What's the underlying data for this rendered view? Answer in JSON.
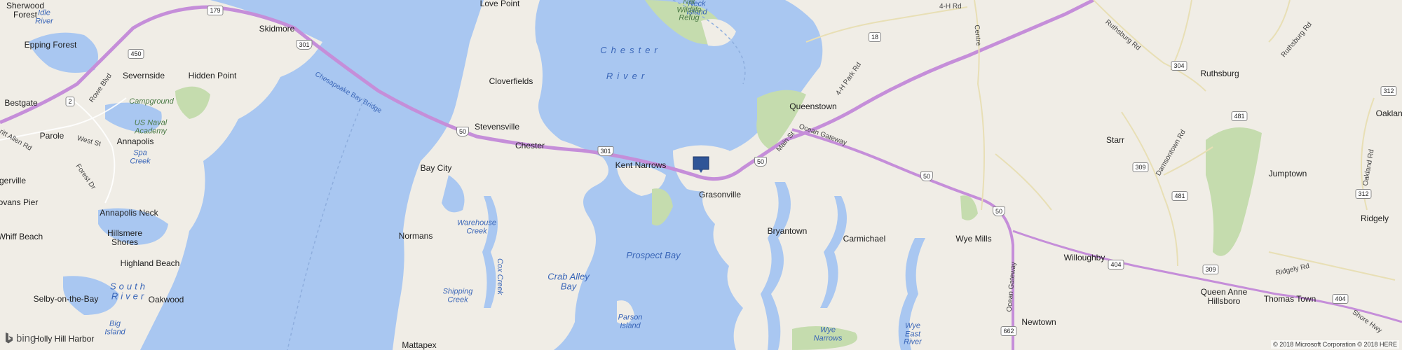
{
  "map": {
    "colors": {
      "water": "#a9c7f1",
      "land": "#f0ede6",
      "park": "#c5dcae",
      "highway": "#c58ed9",
      "marker": "#2f5597"
    },
    "places": [
      {
        "id": "sherwood-forest",
        "text": "Sherwood\nForest"
      },
      {
        "id": "epping-forest",
        "text": "Epping Forest"
      },
      {
        "id": "skidmore",
        "text": "Skidmore"
      },
      {
        "id": "severnside",
        "text": "Severnside"
      },
      {
        "id": "hidden-point",
        "text": "Hidden Point"
      },
      {
        "id": "bestgate",
        "text": "Bestgate"
      },
      {
        "id": "parole",
        "text": "Parole"
      },
      {
        "id": "annapolis",
        "text": "Annapolis"
      },
      {
        "id": "gerville",
        "text": "gerville"
      },
      {
        "id": "ovans-pier",
        "text": "ovans Pier"
      },
      {
        "id": "annapolis-neck",
        "text": "Annapolis Neck"
      },
      {
        "id": "whiff-beach",
        "text": "Whiff Beach"
      },
      {
        "id": "hillsmere-shores",
        "text": "Hillsmere\nShores"
      },
      {
        "id": "highland-beach",
        "text": "Highland Beach"
      },
      {
        "id": "selby-on-the-bay",
        "text": "Selby-on-the-Bay"
      },
      {
        "id": "oakwood",
        "text": "Oakwood"
      },
      {
        "id": "holly-hill-harbor",
        "text": "Holly Hill Harbor"
      },
      {
        "id": "love-point",
        "text": "Love Point"
      },
      {
        "id": "cloverfields",
        "text": "Cloverfields"
      },
      {
        "id": "stevensville",
        "text": "Stevensville"
      },
      {
        "id": "chester",
        "text": "Chester"
      },
      {
        "id": "bay-city",
        "text": "Bay City"
      },
      {
        "id": "normans",
        "text": "Normans"
      },
      {
        "id": "mattapex",
        "text": "Mattapex"
      },
      {
        "id": "kent-narrows",
        "text": "Kent Narrows"
      },
      {
        "id": "grasonville",
        "text": "Grasonville"
      },
      {
        "id": "queenstown",
        "text": "Queenstown"
      },
      {
        "id": "bryantown",
        "text": "Bryantown"
      },
      {
        "id": "carmichael",
        "text": "Carmichael"
      },
      {
        "id": "wye-mills",
        "text": "Wye Mills"
      },
      {
        "id": "starr",
        "text": "Starr"
      },
      {
        "id": "ruthsburg",
        "text": "Ruthsburg"
      },
      {
        "id": "jumptown",
        "text": "Jumptown"
      },
      {
        "id": "oakland",
        "text": "Oakland"
      },
      {
        "id": "ridgely",
        "text": "Ridgely"
      },
      {
        "id": "willoughby",
        "text": "Willoughby"
      },
      {
        "id": "newtown",
        "text": "Newtown"
      },
      {
        "id": "queen-anne-hillsboro",
        "text": "Queen Anne\nHillsboro"
      },
      {
        "id": "thomas-town",
        "text": "Thomas Town"
      }
    ],
    "water_labels": [
      {
        "id": "idle-river",
        "text": "Idle\nRiver"
      },
      {
        "id": "chester-river-1",
        "text": "Chester"
      },
      {
        "id": "chester-river-2",
        "text": "River"
      },
      {
        "id": "warehouse-creek",
        "text": "Warehouse\nCreek"
      },
      {
        "id": "cox-creek",
        "text": "Cox Creek"
      },
      {
        "id": "prospect-bay",
        "text": "Prospect Bay"
      },
      {
        "id": "crab-alley-bay",
        "text": "Crab Alley\nBay"
      },
      {
        "id": "shipping-creek",
        "text": "Shipping\nCreek"
      },
      {
        "id": "south-river",
        "text": "South\nRiver"
      },
      {
        "id": "spa-creek",
        "text": "Spa\nCreek"
      },
      {
        "id": "big-island",
        "text": "Big\nIsland"
      },
      {
        "id": "parson-island",
        "text": "Parson\nIsland"
      },
      {
        "id": "wye-narrows",
        "text": "Wye\nNarrows"
      },
      {
        "id": "wye-east-river",
        "text": "Wye\nEast\nRiver"
      },
      {
        "id": "neck-island",
        "text": "Neck\nIsland"
      }
    ],
    "park_labels": [
      {
        "id": "campground",
        "text": "Campground"
      },
      {
        "id": "us-naval-academy",
        "text": "US Naval\nAcademy"
      },
      {
        "id": "wildlife-refuge",
        "text": "Nat\nWildlife\nRefug"
      }
    ],
    "roads": [
      {
        "id": "rowe-blvd",
        "text": "Rowe Blvd"
      },
      {
        "id": "west-st",
        "text": "West St"
      },
      {
        "id": "forest-dr",
        "text": "Forest Dr"
      },
      {
        "id": "chesapeake-bay-bridge",
        "text": "Chesapeake Bay Bridge"
      },
      {
        "id": "4h-park-rd",
        "text": "4-H Park Rd"
      },
      {
        "id": "main-st",
        "text": "Main St"
      },
      {
        "id": "ocean-gateway",
        "text": "Ocean Gateway"
      },
      {
        "id": "ocean-gateway-2",
        "text": "Ocean Gateway"
      },
      {
        "id": "ruthsburg-rd",
        "text": "Ruthsburg Rd"
      },
      {
        "id": "ruthsburg-rd-2",
        "text": "Ruthsburg Rd"
      },
      {
        "id": "damsontown-rd",
        "text": "Damsontown Rd"
      },
      {
        "id": "oakland-rd",
        "text": "Oakland Rd"
      },
      {
        "id": "ridgely-rd",
        "text": "Ridgely Rd"
      },
      {
        "id": "shore-hwy",
        "text": "Shore Hwy"
      },
      {
        "id": "centre-rd",
        "text": "Centre"
      },
      {
        "id": "ritchie-hwy",
        "text": "ritt Allen Rd"
      },
      {
        "id": "4h-rd",
        "text": "4-H Rd"
      }
    ],
    "shields": [
      {
        "id": "r179",
        "text": "179"
      },
      {
        "id": "r450",
        "text": "450"
      },
      {
        "id": "r301a",
        "text": "301"
      },
      {
        "id": "r2",
        "text": "2"
      },
      {
        "id": "r50a",
        "text": "50"
      },
      {
        "id": "r301b",
        "text": "301"
      },
      {
        "id": "r50b",
        "text": "50"
      },
      {
        "id": "r18",
        "text": "18"
      },
      {
        "id": "r50c",
        "text": "50"
      },
      {
        "id": "r50d",
        "text": "50"
      },
      {
        "id": "r304",
        "text": "304"
      },
      {
        "id": "r309a",
        "text": "309"
      },
      {
        "id": "r481a",
        "text": "481"
      },
      {
        "id": "r481b",
        "text": "481"
      },
      {
        "id": "r312a",
        "text": "312"
      },
      {
        "id": "r312b",
        "text": "312"
      },
      {
        "id": "r404a",
        "text": "404"
      },
      {
        "id": "r309b",
        "text": "309"
      },
      {
        "id": "r404b",
        "text": "404"
      },
      {
        "id": "r662",
        "text": "662"
      }
    ],
    "logo": "bing",
    "copyright": "© 2018 Microsoft Corporation © 2018 HERE"
  }
}
